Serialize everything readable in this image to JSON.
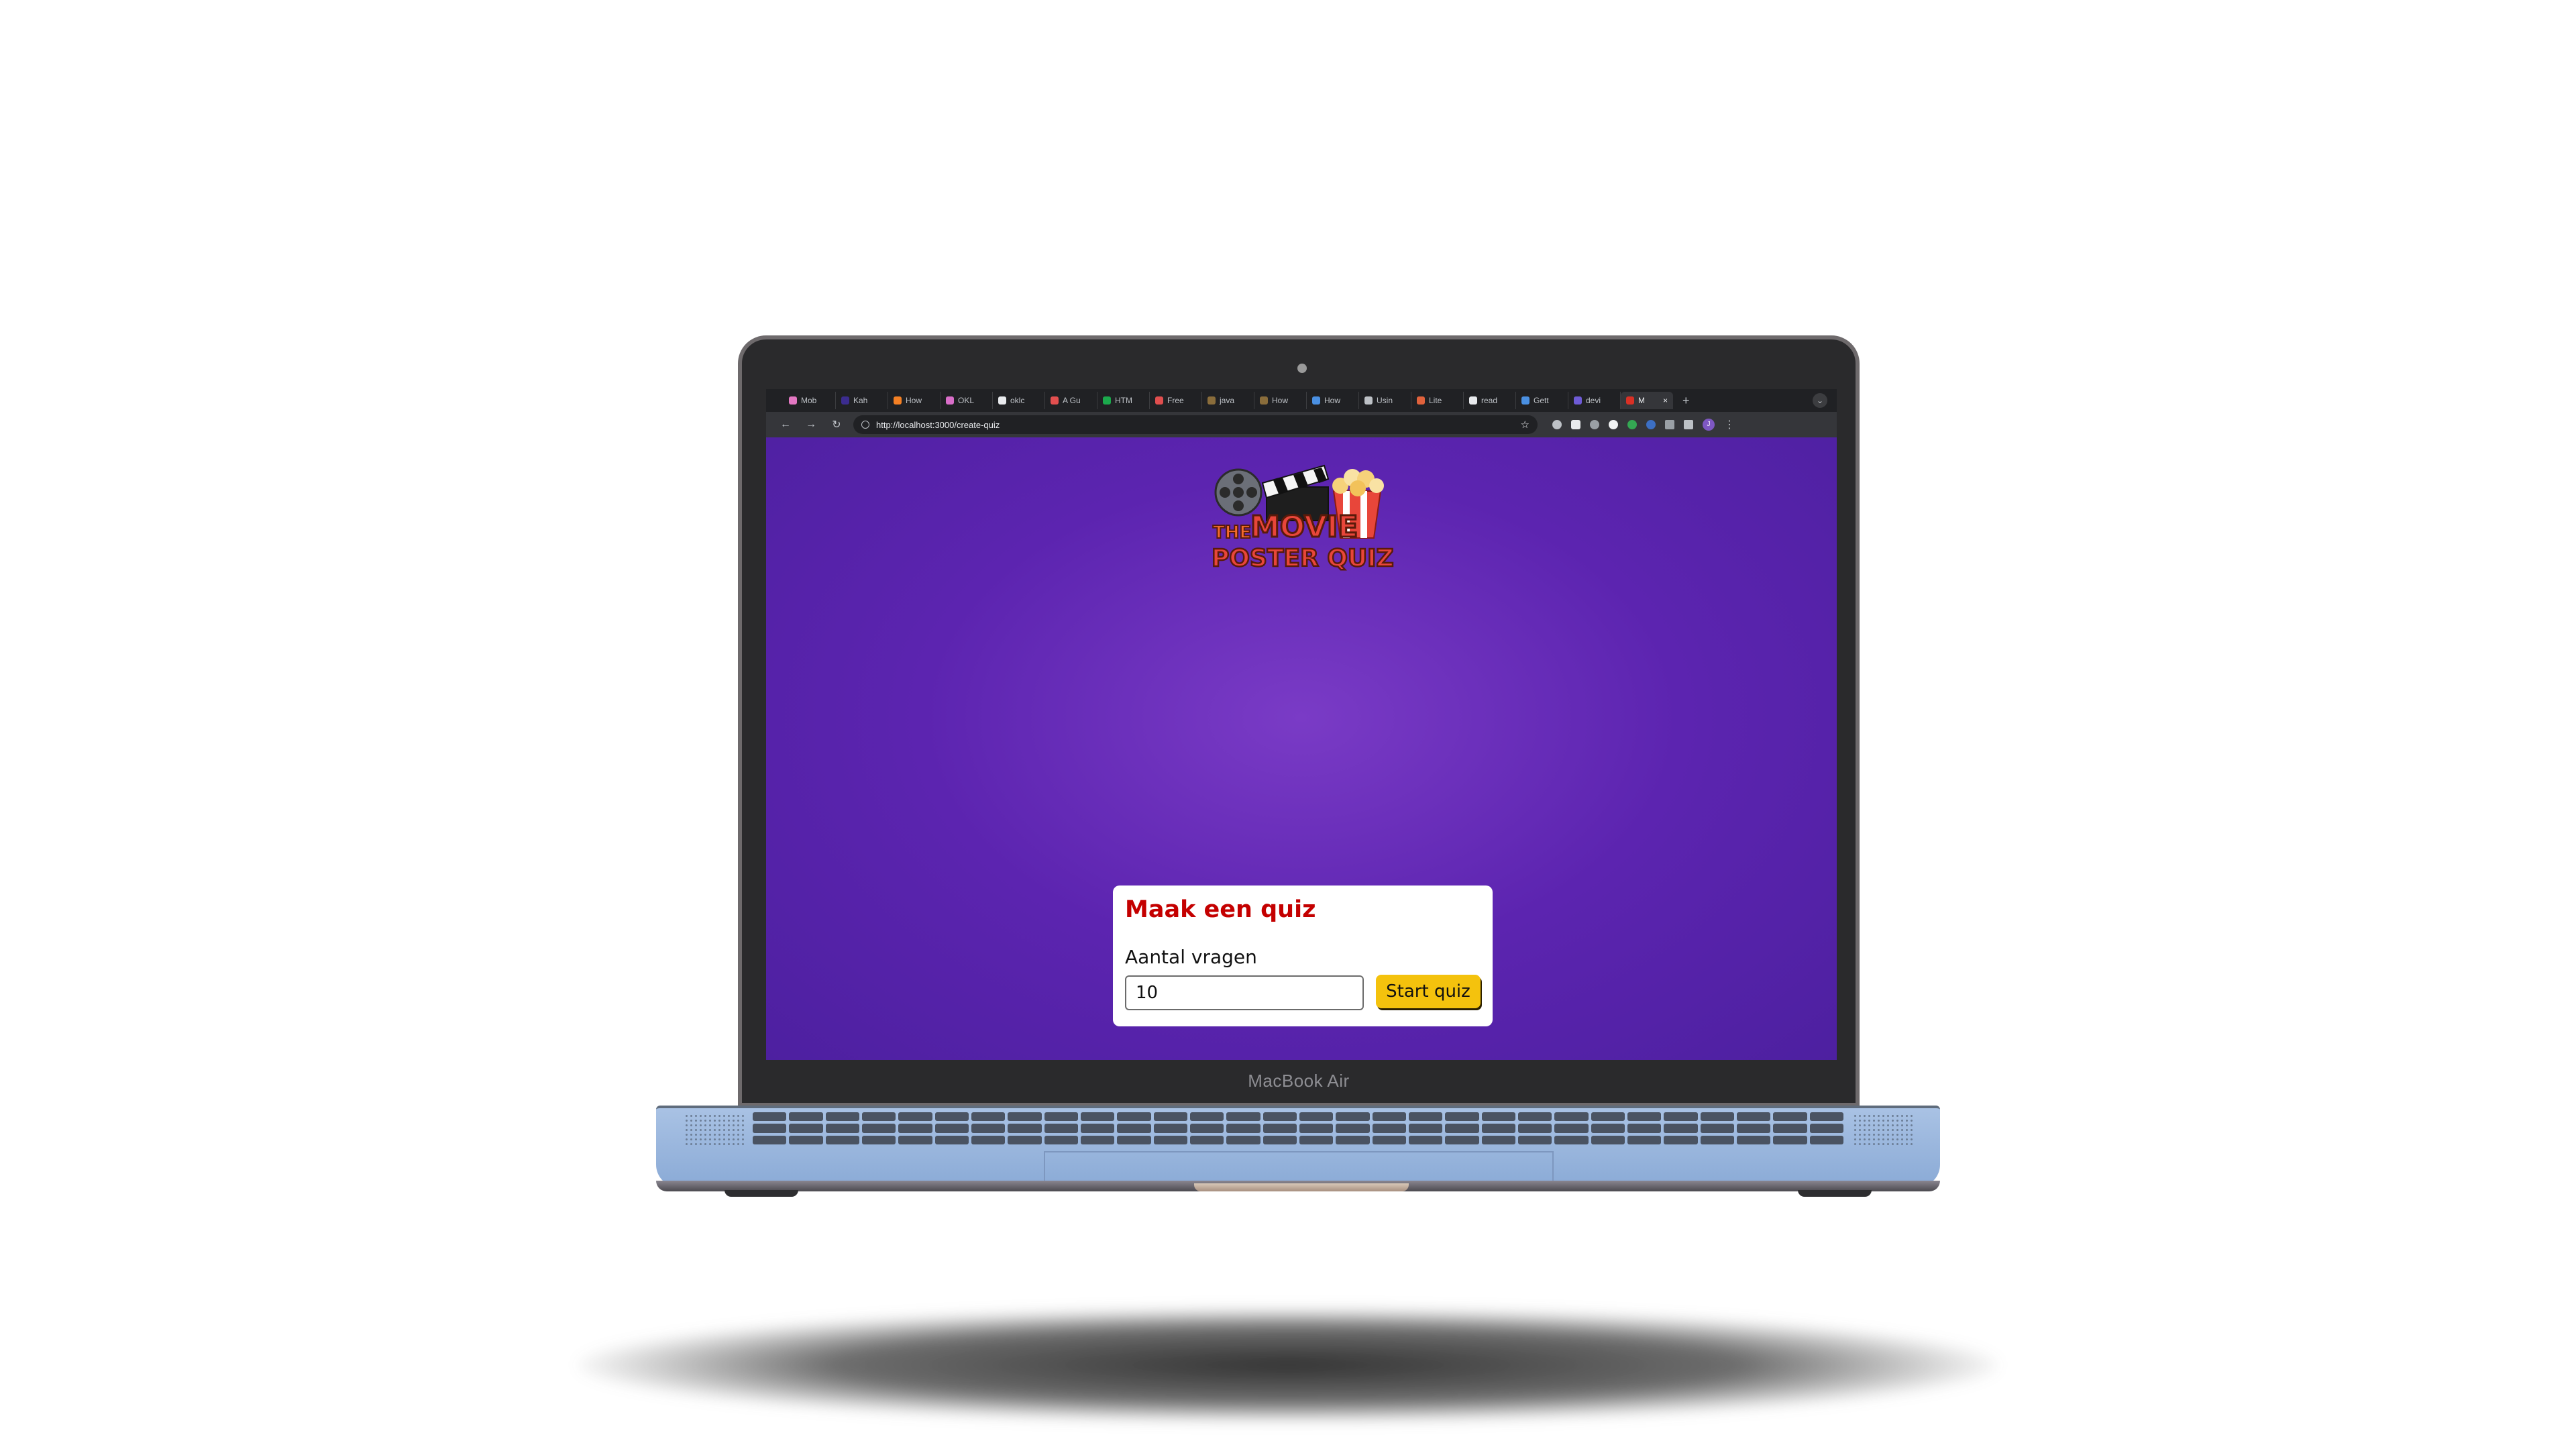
{
  "browser": {
    "tabs": [
      {
        "label": "Mob",
        "color": "#e377c2"
      },
      {
        "label": "Kah",
        "color": "#3b2c8f"
      },
      {
        "label": "How",
        "color": "#f48024"
      },
      {
        "label": "OKL",
        "color": "#d96ec9"
      },
      {
        "label": "oklc",
        "color": "#e8eaed"
      },
      {
        "label": "A Gu",
        "color": "#e34f4f"
      },
      {
        "label": "HTM",
        "color": "#1ba94c"
      },
      {
        "label": "Free",
        "color": "#e04e4e"
      },
      {
        "label": "java",
        "color": "#8a6d3b"
      },
      {
        "label": "How",
        "color": "#8a6d3b"
      },
      {
        "label": "How",
        "color": "#4a90e2"
      },
      {
        "label": "Usin",
        "color": "#bdc1c6"
      },
      {
        "label": "Lite",
        "color": "#e0623c"
      },
      {
        "label": "read",
        "color": "#e8eaed"
      },
      {
        "label": "Gett",
        "color": "#4a90e2"
      },
      {
        "label": "devi",
        "color": "#6e5bd6"
      },
      {
        "label": "M",
        "color": "#d93025",
        "active": true
      }
    ],
    "url": "http://localhost:3000/create-quiz",
    "new_tab": "+",
    "profile_initial": "J"
  },
  "logo": {
    "line1_small": "THE",
    "line1_big": "MOVIE",
    "line2": "POSTER QUIZ"
  },
  "card": {
    "title": "Maak een quiz",
    "field_label": "Aantal vragen",
    "field_value": "10",
    "button_label": "Start quiz"
  },
  "device": {
    "label": "MacBook Air"
  }
}
